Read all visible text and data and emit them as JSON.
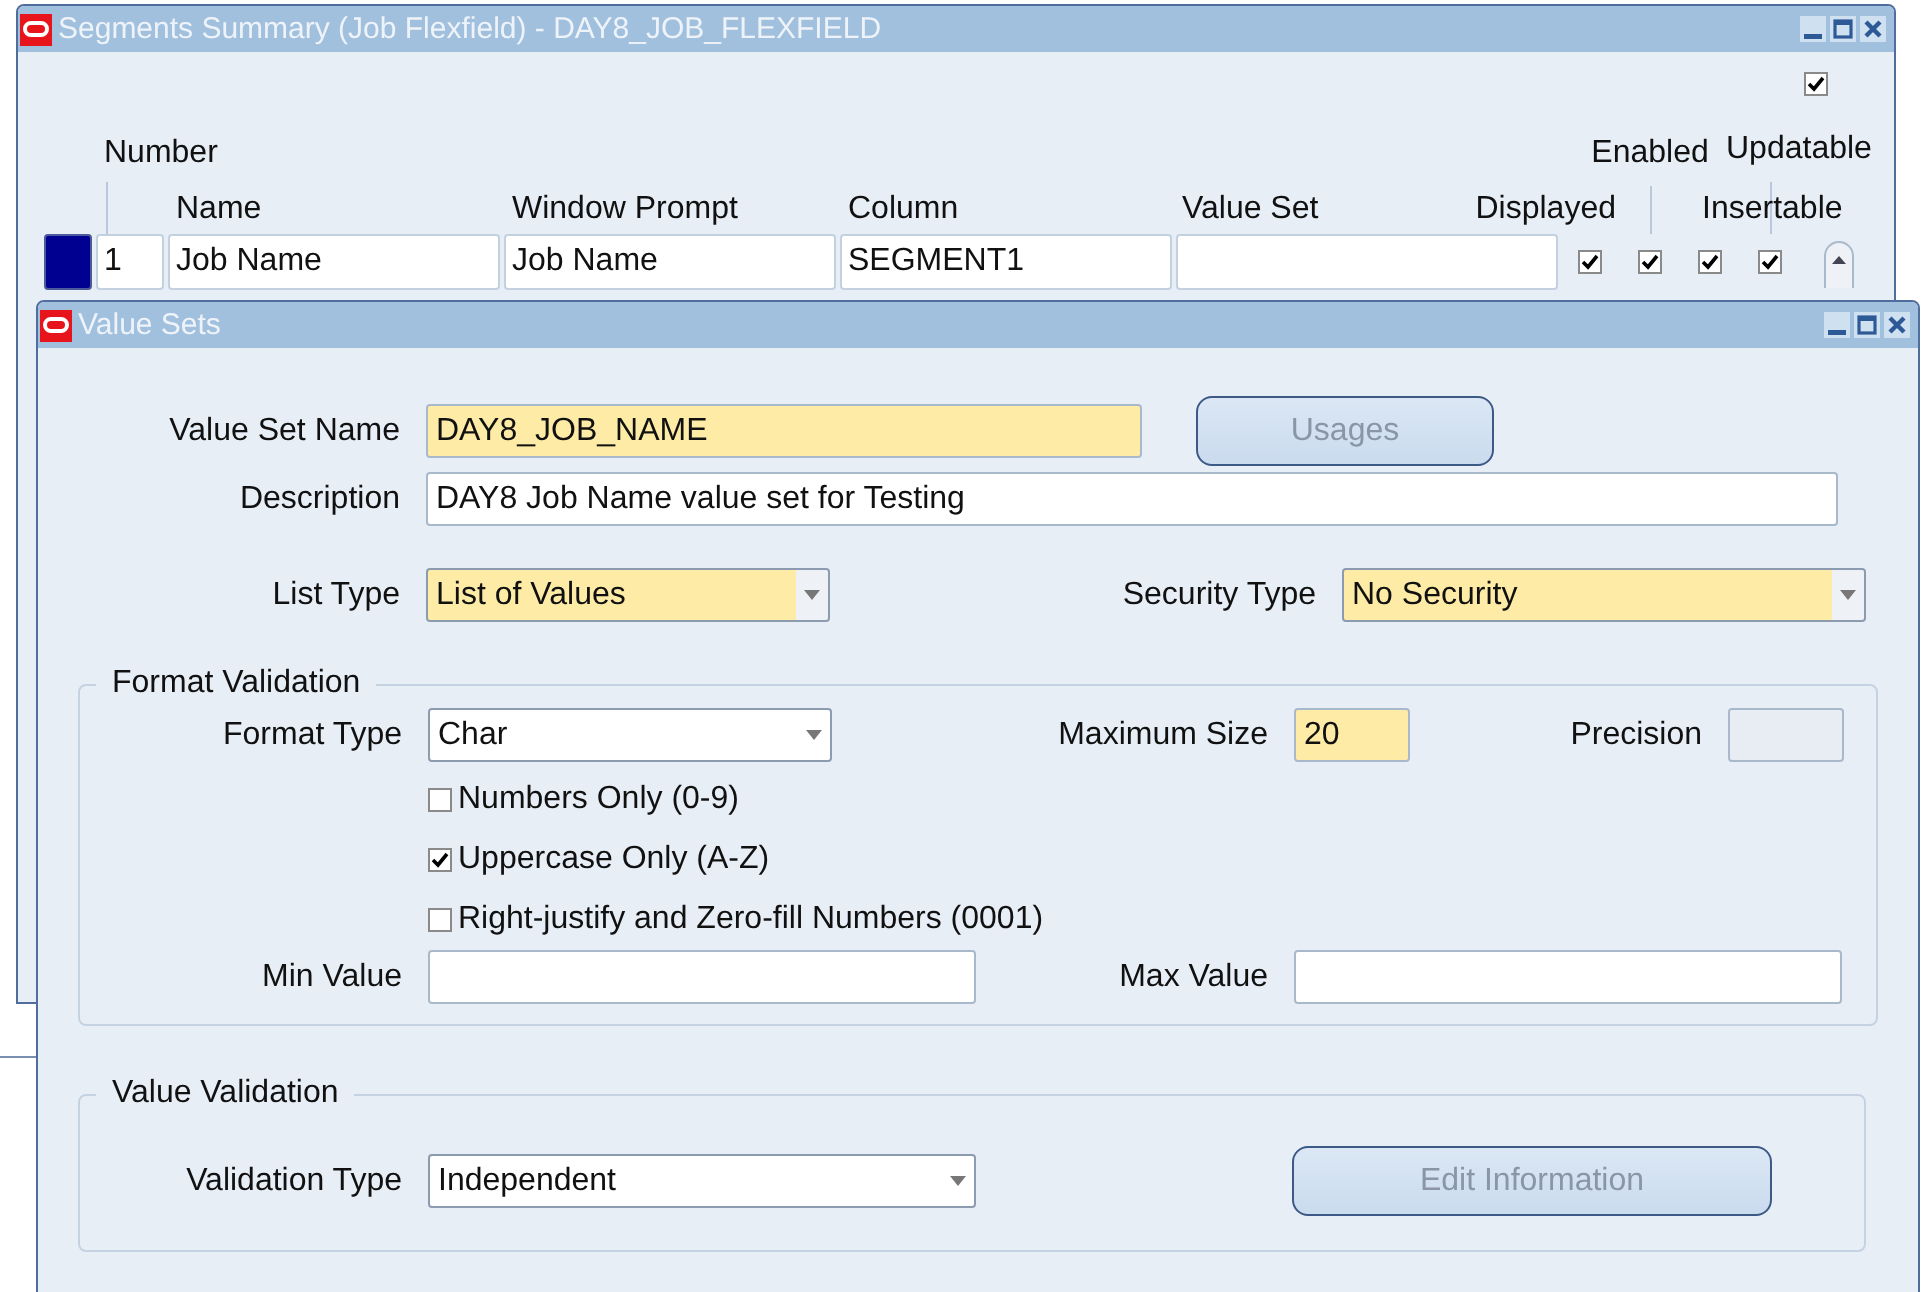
{
  "segments_window": {
    "title": "Segments Summary (Job Flexfield) - DAY8_JOB_FLEXFIELD",
    "active": false,
    "header_checkbox": {
      "checked": true
    },
    "columns": [
      "Number",
      "Name",
      "Window Prompt",
      "Column",
      "Value Set",
      "Displayed",
      "Enabled",
      "Insertable",
      "Updatable"
    ],
    "rows": [
      {
        "selected": true,
        "number": "1",
        "name": "Job Name",
        "window_prompt": "Job Name",
        "column": "SEGMENT1",
        "displayed": true,
        "enabled": true,
        "insertable": true,
        "updatable": true
      }
    ]
  },
  "value_sets_window": {
    "title": "Value Sets",
    "active": false,
    "value_set_name": {
      "label": "Value Set Name",
      "value": "DAY8_JOB_NAME",
      "required": true
    },
    "usages_button": {
      "label": "Usages",
      "disabled": true
    },
    "description": {
      "label": "Description",
      "value": "DAY8 Job Name value set for Testing",
      "required": false
    },
    "list_type": {
      "label": "List Type",
      "value": "List of Values",
      "required": true
    },
    "security_type": {
      "label": "Security Type",
      "value": "No Security",
      "required": true
    },
    "format_validation": {
      "title": "Format Validation",
      "format_type": {
        "label": "Format Type",
        "value": "Char",
        "required": false
      },
      "maximum_size": {
        "label": "Maximum Size",
        "value": "20",
        "required": true
      },
      "precision": {
        "label": "Precision",
        "disabled": true
      },
      "options": [
        {
          "label": "Numbers Only (0-9)",
          "checked": false
        },
        {
          "label": "Uppercase Only (A-Z)",
          "checked": true
        },
        {
          "label": "Right-justify and Zero-fill Numbers (0001)",
          "checked": false
        }
      ],
      "min_value": {
        "label": "Min Value"
      },
      "max_value": {
        "label": "Max Value"
      }
    },
    "value_validation": {
      "title": "Value Validation",
      "validation_type": {
        "label": "Validation Type",
        "value": "Independent",
        "required": false
      },
      "edit_button": {
        "label": "Edit Information",
        "disabled": true
      }
    }
  }
}
